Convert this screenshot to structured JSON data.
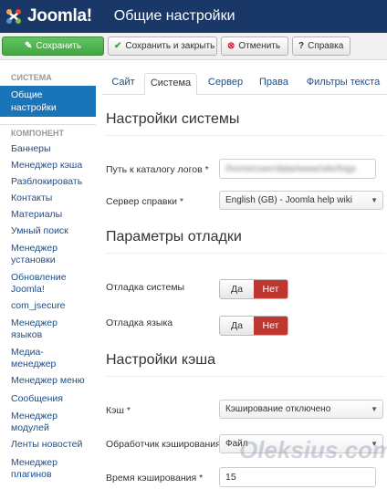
{
  "header": {
    "logo_text": "Joomla!",
    "title": "Общие настройки"
  },
  "toolbar": {
    "save": "Сохранить",
    "save_close": "Сохранить и закрыть",
    "cancel": "Отменить",
    "help": "Справка"
  },
  "sidebar": {
    "system_heading": "СИСТЕМА",
    "active_item": "Общие настройки",
    "component_heading": "КОМПОНЕНТ",
    "items": [
      "Баннеры",
      "Менеджер кэша",
      "Разблокировать",
      "Контакты",
      "Материалы",
      "Умный поиск",
      "Менеджер установки",
      "Обновление Joomla!",
      "com_jsecure",
      "Менеджер языков",
      "Медиа-менеджер",
      "Менеджер меню",
      "Сообщения",
      "Менеджер модулей",
      "Ленты новостей",
      "Менеджер плагинов"
    ]
  },
  "tabs": [
    "Сайт",
    "Система",
    "Сервер",
    "Права",
    "Фильтры текста"
  ],
  "system_settings": {
    "title": "Настройки системы",
    "log_path_label": "Путь к каталогу логов *",
    "log_path_value": "/home/user/data/www/site/logs",
    "help_server_label": "Сервер справки *",
    "help_server_value": "English (GB) - Joomla help wiki"
  },
  "debug_settings": {
    "title": "Параметры отладки",
    "debug_system_label": "Отладка системы",
    "debug_language_label": "Отладка языка",
    "yes": "Да",
    "no": "Нет"
  },
  "cache_settings": {
    "title": "Настройки кэша",
    "cache_label": "Кэш *",
    "cache_value": "Кэширование отключено",
    "handler_label": "Обработчик кэширования",
    "handler_value": "Файл",
    "time_label": "Время кэширования *",
    "time_value": "15"
  },
  "watermark": "Oleksius.com",
  "colors": {
    "header_bg": "#1a3867",
    "save_green": "#45a245",
    "active_blue": "#1a74b8",
    "toggle_red": "#bd362f"
  }
}
